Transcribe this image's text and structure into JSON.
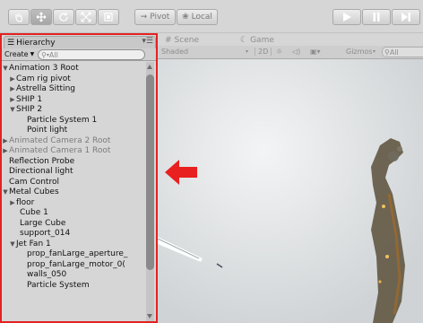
{
  "toolbar": {
    "pivot_label": "Pivot",
    "local_label": "Local",
    "tools": [
      "hand-tool-icon",
      "move-tool-icon",
      "rotate-tool-icon",
      "scale-tool-icon",
      "rect-tool-icon"
    ],
    "play_controls": [
      "play-icon",
      "pause-icon",
      "step-icon"
    ]
  },
  "hierarchy": {
    "title": "Hierarchy",
    "create_label": "Create",
    "search_placeholder": "All",
    "items": [
      {
        "label": "Animation 3 Root",
        "indent": 0,
        "fold": "open",
        "dim": false
      },
      {
        "label": "Cam rig pivot",
        "indent": 1,
        "fold": "closed",
        "dim": false
      },
      {
        "label": "Astrella Sitting",
        "indent": 1,
        "fold": "closed",
        "dim": false
      },
      {
        "label": "SHIP 1",
        "indent": 1,
        "fold": "closed",
        "dim": false
      },
      {
        "label": "SHIP 2",
        "indent": 1,
        "fold": "open",
        "dim": false
      },
      {
        "label": "Particle System 1",
        "indent": 2,
        "fold": "none",
        "dim": false
      },
      {
        "label": "Point light",
        "indent": 2,
        "fold": "none",
        "dim": false
      },
      {
        "label": "Animated Camera 2 Root",
        "indent": 0,
        "fold": "closed",
        "dim": true
      },
      {
        "label": "Animated Camera 1 Root",
        "indent": 0,
        "fold": "closed",
        "dim": true
      },
      {
        "label": "Reflection Probe",
        "indent": 0,
        "fold": "none",
        "dim": false
      },
      {
        "label": "Directional light",
        "indent": 0,
        "fold": "none",
        "dim": false
      },
      {
        "label": "Cam Control",
        "indent": 0,
        "fold": "none",
        "dim": false
      },
      {
        "label": "Metal Cubes",
        "indent": 0,
        "fold": "open",
        "dim": false
      },
      {
        "label": "floor",
        "indent": 1,
        "fold": "closed",
        "dim": false
      },
      {
        "label": "Cube 1",
        "indent": 1,
        "fold": "none",
        "dim": false
      },
      {
        "label": "Large Cube",
        "indent": 1,
        "fold": "none",
        "dim": false
      },
      {
        "label": "support_014",
        "indent": 1,
        "fold": "none",
        "dim": false
      },
      {
        "label": "Jet Fan 1",
        "indent": 1,
        "fold": "open",
        "dim": false
      },
      {
        "label": "prop_fanLarge_aperture_",
        "indent": 2,
        "fold": "none",
        "dim": false
      },
      {
        "label": "prop_fanLarge_motor_0(",
        "indent": 2,
        "fold": "none",
        "dim": false
      },
      {
        "label": "walls_050",
        "indent": 2,
        "fold": "none",
        "dim": false
      },
      {
        "label": "Particle System",
        "indent": 2,
        "fold": "none",
        "dim": false
      }
    ]
  },
  "scene": {
    "scene_tab": "Scene",
    "game_tab": "Game",
    "shading_label": "Shaded",
    "mode_2d_label": "2D",
    "gizmos_label": "Gizmos",
    "search_placeholder": "All"
  },
  "colors": {
    "highlight_border": "#e32222",
    "arrow": "#e8201f"
  }
}
